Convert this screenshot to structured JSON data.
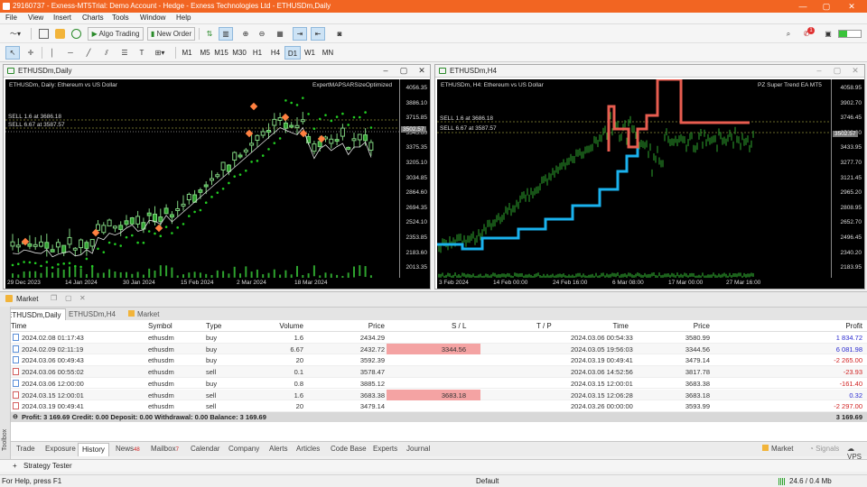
{
  "window": {
    "title": "29160737 - Exness-MT5Trial: Demo Account - Hedge - Exness Technologies Ltd - ETHUSDm,Daily"
  },
  "menu": [
    "File",
    "View",
    "Insert",
    "Charts",
    "Tools",
    "Window",
    "Help"
  ],
  "toolbar": {
    "algo_trading": "Algo Trading",
    "new_order": "New Order",
    "notif_count": "1"
  },
  "timeframes": [
    "M1",
    "M5",
    "M15",
    "M30",
    "H1",
    "H4",
    "D1",
    "W1",
    "MN"
  ],
  "selected_timeframe": "D1",
  "chart1": {
    "tab_title": "ETHUSDm,Daily",
    "info": "ETHUSDm, Daily:  Ethereum vs US Dollar",
    "ea": "ExpertMAPSARSizeOptimized",
    "sell1": "SELL 1.6 at 3686.18",
    "sell2": "SELL 6.67 at 3587.57",
    "price_box": "3502.57",
    "y_labels": [
      "4056.35",
      "3886.10",
      "3715.85",
      "3545.60",
      "3375.35",
      "3205.10",
      "3034.85",
      "2864.60",
      "2694.35",
      "2524.10",
      "2353.85",
      "2183.60",
      "2013.35"
    ],
    "x_labels": [
      "29 Dec 2023",
      "14 Jan 2024",
      "30 Jan 2024",
      "15 Feb 2024",
      "2 Mar 2024",
      "18 Mar 2024"
    ]
  },
  "chart2": {
    "tab_title": "ETHUSDm,H4",
    "info": "ETHUSDm, H4:  Ethereum vs US Dollar",
    "ea": "PZ Super Trend EA MT5",
    "sell1": "SELL 1.6 at 3686.18",
    "sell2": "SELL 6.67 at 3587.57",
    "price_box": "3502.57",
    "y_labels": [
      "4058.95",
      "3902.70",
      "3746.45",
      "3590.20",
      "3433.95",
      "3277.70",
      "3121.45",
      "2965.20",
      "2808.95",
      "2652.70",
      "2496.45",
      "2340.20",
      "2183.95"
    ],
    "x_labels": [
      "3 Feb 2024",
      "14 Feb 00:00",
      "24 Feb 16:00",
      "6 Mar 08:00",
      "17 Mar 00:00",
      "27 Mar 16:00"
    ]
  },
  "market_header": "Market",
  "chart_tabs": [
    "ETHUSDm,Daily",
    "ETHUSDm,H4",
    "Market"
  ],
  "table": {
    "headers": [
      "Time",
      "Symbol",
      "Type",
      "Volume",
      "Price",
      "S / L",
      "T / P",
      "Time",
      "Price",
      "Profit"
    ],
    "rows": [
      [
        "2024.02.08 01:17:43",
        "ethusdm",
        "buy",
        "1.6",
        "2434.29",
        "",
        "",
        "2024.03.06 00:54:33",
        "3580.99",
        "1 834.72"
      ],
      [
        "2024.02.09 02:11:19",
        "ethusdm",
        "buy",
        "6.67",
        "2432.72",
        "3344.56",
        "",
        "2024.03.05 19:56:03",
        "3344.56",
        "6 081.98"
      ],
      [
        "2024.03.06 00:49:43",
        "ethusdm",
        "buy",
        "20",
        "3592.39",
        "",
        "",
        "2024.03.19 00:49:41",
        "3479.14",
        "-2 265.00"
      ],
      [
        "2024.03.06 00:55:02",
        "ethusdm",
        "sell",
        "0.1",
        "3578.47",
        "",
        "",
        "2024.03.06 14:52:56",
        "3817.78",
        "-23.93"
      ],
      [
        "2024.03.06 12:00:00",
        "ethusdm",
        "buy",
        "0.8",
        "3885.12",
        "",
        "",
        "2024.03.15 12:00:01",
        "3683.38",
        "-161.40"
      ],
      [
        "2024.03.15 12:00:01",
        "ethusdm",
        "sell",
        "1.6",
        "3683.38",
        "3683.18",
        "",
        "2024.03.15 12:06:28",
        "3683.18",
        "0.32"
      ],
      [
        "2024.03.19 00:49:41",
        "ethusdm",
        "sell",
        "20",
        "3479.14",
        "",
        "",
        "2024.03.26 00:00:00",
        "3593.99",
        "-2 297.00"
      ]
    ],
    "summary": "Profit: 3 169.69  Credit: 0.00  Deposit: 0.00  Withdrawal: 0.00  Balance: 3 169.69",
    "summary_total": "3 169.69"
  },
  "bottom_tabs": [
    "Trade",
    "Exposure",
    "History",
    "News",
    "Mailbox",
    "Calendar",
    "Company",
    "Alerts",
    "Articles",
    "Code Base",
    "Experts",
    "Journal"
  ],
  "news_count": "48",
  "mailbox_count": "7",
  "right_tabs": [
    "Market",
    "Signals",
    "VPS"
  ],
  "toolbox_label": "Toolbox",
  "strategy_tester": "Strategy Tester",
  "status": {
    "help": "For Help, press F1",
    "profile": "Default",
    "traffic": "24.6 / 0.4 Mb"
  },
  "colors": {
    "title_bar": "#f26522",
    "candle_up": "#2ea32e",
    "sar": "#22cc22",
    "supertrend_up": "#1ab2ee",
    "supertrend_down": "#e85d50",
    "loss_cell": "#f4a3a3"
  }
}
